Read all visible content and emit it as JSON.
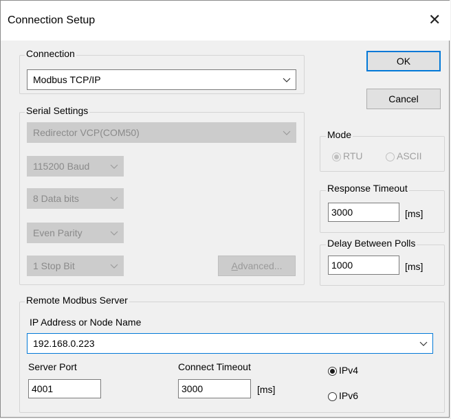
{
  "dialog": {
    "title": "Connection Setup"
  },
  "connection": {
    "group_label": "Connection",
    "type": "Modbus TCP/IP"
  },
  "buttons": {
    "ok": "OK",
    "cancel": "Cancel",
    "advanced_prefix": "A",
    "advanced_rest": "dvanced..."
  },
  "serial": {
    "group_label": "Serial Settings",
    "port": "Redirector VCP(COM50)",
    "baud": "115200 Baud",
    "data_bits": "8 Data bits",
    "parity": "Even Parity",
    "stop_bits": "1 Stop Bit"
  },
  "mode": {
    "group_label": "Mode",
    "rtu": "RTU",
    "ascii": "ASCII",
    "selected": "RTU"
  },
  "response_timeout": {
    "group_label": "Response Timeout",
    "value": "3000",
    "unit": "[ms]"
  },
  "delay_between_polls": {
    "group_label": "Delay Between Polls",
    "value": "1000",
    "unit": "[ms]"
  },
  "remote": {
    "group_label": "Remote Modbus Server",
    "ip_label": "IP Address or Node Name",
    "ip_value": "192.168.0.223",
    "server_port_label": "Server Port",
    "server_port": "4001",
    "connect_timeout_label": "Connect Timeout",
    "connect_timeout": "3000",
    "connect_timeout_unit": "[ms]",
    "ipv4": "IPv4",
    "ipv6": "IPv6",
    "selected_ip_version": "IPv4"
  },
  "icons": {
    "close": "close-icon",
    "dropdown": "chevron-down-icon"
  },
  "colors": {
    "focus_accent": "#0078d7",
    "disabled_text": "#9a9a9a"
  }
}
